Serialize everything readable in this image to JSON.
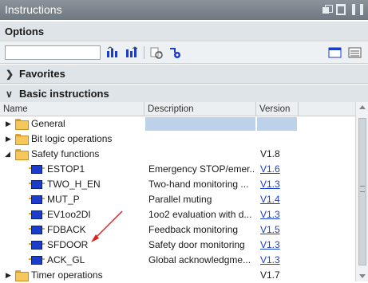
{
  "window": {
    "title": "Instructions"
  },
  "options": {
    "label": "Options"
  },
  "toolbar": {
    "search_value": "",
    "icons": [
      "toggle-columns-icon",
      "toggle-columns-alt-icon",
      "refresh-icon",
      "settings-icon",
      "layout-view-icon",
      "list-view-icon"
    ]
  },
  "sections": {
    "favorites": "Favorites",
    "basic": "Basic instructions"
  },
  "table": {
    "headers": {
      "name": "Name",
      "description": "Description",
      "version": "Version"
    },
    "rows": [
      {
        "name": "General",
        "description": "",
        "version": ""
      },
      {
        "name": "Bit logic operations",
        "description": "",
        "version": ""
      },
      {
        "name": "Safety functions",
        "description": "",
        "version": "V1.8"
      },
      {
        "name": "ESTOP1",
        "description": "Emergency STOP/emer...",
        "version": "V1.6"
      },
      {
        "name": "TWO_H_EN",
        "description": "Two-hand monitoring ...",
        "version": "V1.3"
      },
      {
        "name": "MUT_P",
        "description": "Parallel muting",
        "version": "V1.4"
      },
      {
        "name": "EV1oo2DI",
        "description": "1oo2 evaluation with d...",
        "version": "V1.3"
      },
      {
        "name": "FDBACK",
        "description": "Feedback monitoring",
        "version": "V1.5"
      },
      {
        "name": "SFDOOR",
        "description": "Safety door monitoring",
        "version": "V1.3"
      },
      {
        "name": "ACK_GL",
        "description": "Global acknowledgme...",
        "version": "V1.3"
      },
      {
        "name": "Timer operations",
        "description": "",
        "version": "V1.7"
      }
    ]
  },
  "colors": {
    "annotation_arrow": "#e02020",
    "link": "#1a3fcc",
    "highlight": "#bcd1ea"
  }
}
